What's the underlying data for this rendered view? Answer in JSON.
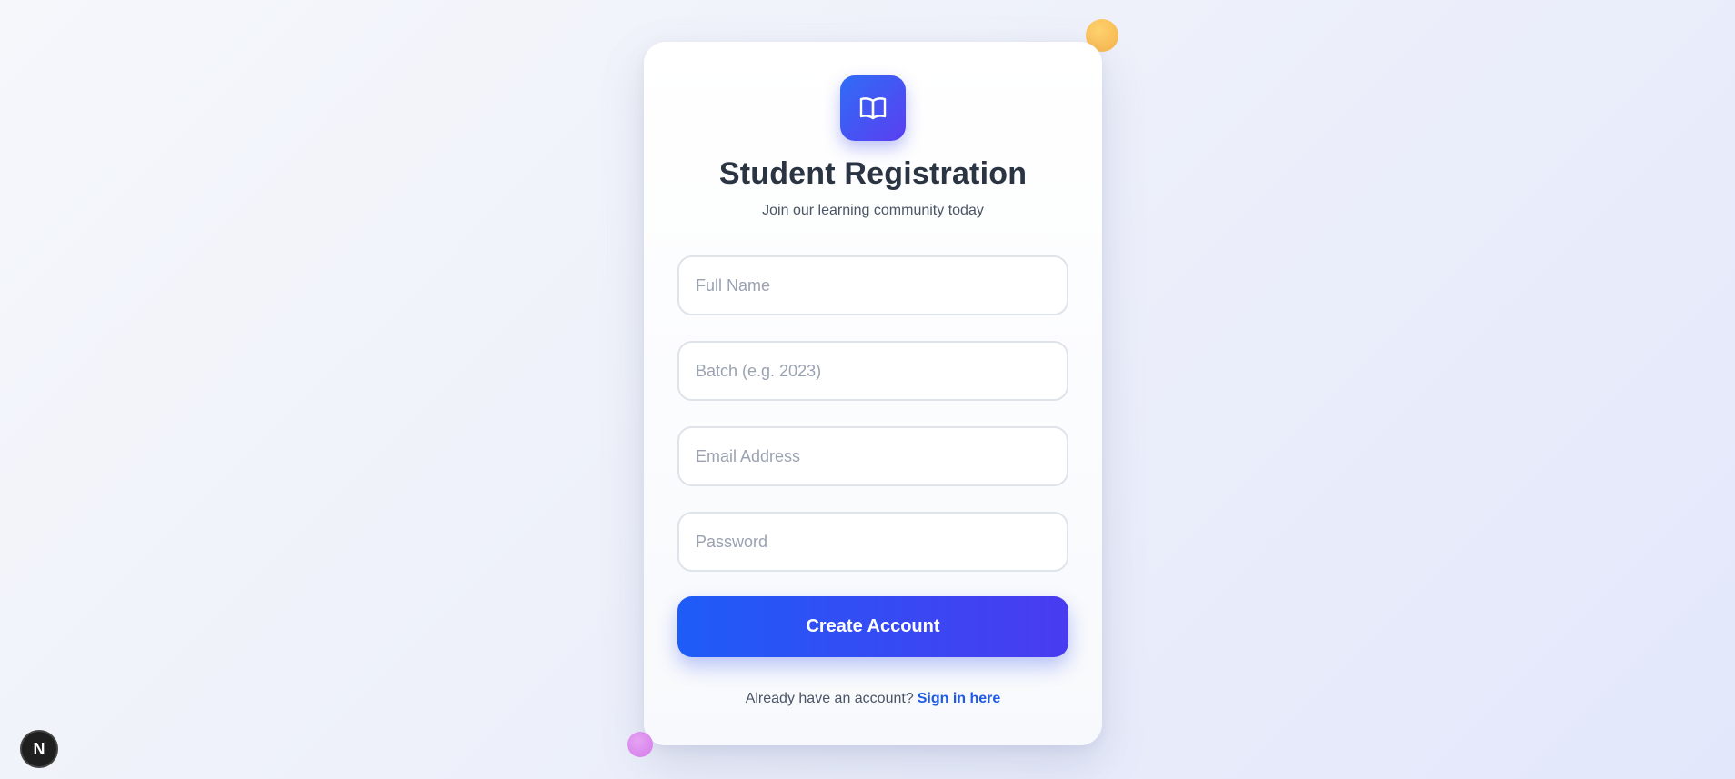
{
  "app": {
    "title": "Student Registration",
    "subtitle": "Join our learning community today",
    "logo_icon": "book-open-icon"
  },
  "form": {
    "full_name": {
      "placeholder": "Full Name",
      "value": ""
    },
    "batch": {
      "placeholder": "Batch (e.g. 2023)",
      "value": ""
    },
    "email": {
      "placeholder": "Email Address",
      "value": ""
    },
    "password": {
      "placeholder": "Password",
      "value": ""
    },
    "submit_label": "Create Account"
  },
  "footer": {
    "prompt": "Already have an account?",
    "link_label": "Sign in here"
  },
  "dev_badge": {
    "label": "N"
  },
  "colors": {
    "accent_start": "#1e5cf7",
    "accent_end": "#4a3bf0",
    "link": "#1f5ae6",
    "title": "#2b3443"
  }
}
